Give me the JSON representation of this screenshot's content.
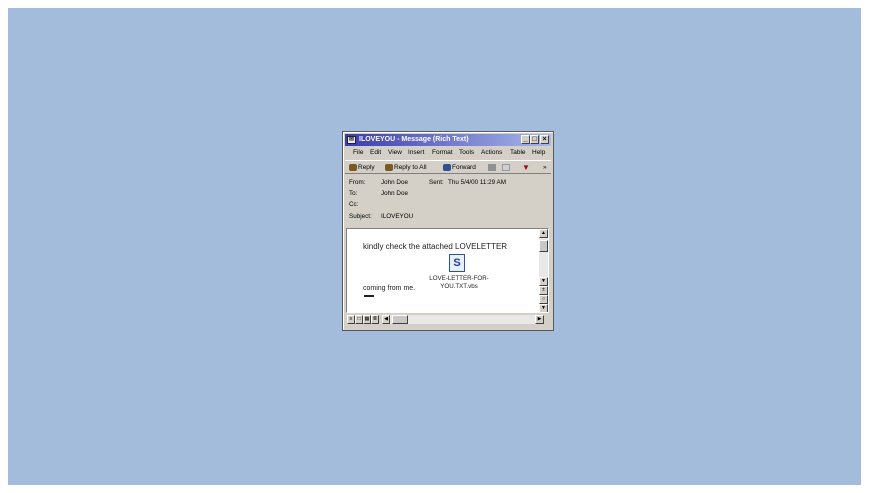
{
  "window": {
    "title": "ILOVEYOU - Message (Rich Text)",
    "controls": {
      "minimize": "_",
      "maximize": "□",
      "close": "×"
    }
  },
  "menu": [
    "File",
    "Edit",
    "View",
    "Insert",
    "Format",
    "Tools",
    "Actions",
    "Table",
    "Help"
  ],
  "toolbar": {
    "reply": "Reply",
    "reply_all": "Reply to All",
    "forward": "Forward",
    "overflow": "»"
  },
  "headers": {
    "from_label": "From:",
    "from_value": "John Doe",
    "sent_label": "Sent:",
    "sent_value": "Thu 5/4/00 11:29 AM",
    "to_label": "To:",
    "to_value": "John Doe",
    "cc_label": "Cc:",
    "cc_value": "",
    "subject_label": "Subject:",
    "subject_value": "ILOVEYOU"
  },
  "message": {
    "body": "kindly check the attached LOVELETTER",
    "attachment": "LOVE-LETTER-FOR-YOU.TXT.vbs",
    "closing": "coming from me."
  },
  "icons": [
    "envelope-icon",
    "reply-icon",
    "reply-all-icon",
    "forward-icon",
    "print-icon",
    "delete-icon",
    "flag-icon",
    "vbs-file-icon"
  ],
  "colors": {
    "desktop": "#a3bcdb",
    "titlebar_start": "#3b3bb0",
    "titlebar_end": "#a8b8e8",
    "window": "#d4d0c8"
  }
}
